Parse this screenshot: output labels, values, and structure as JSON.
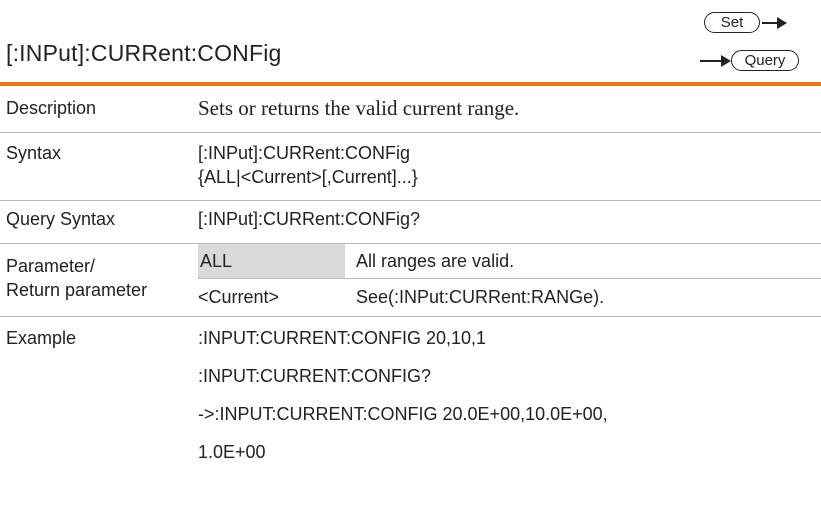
{
  "header": {
    "title": "[:INPut]:CURRent:CONFig",
    "set_badge": "Set",
    "query_badge": "Query"
  },
  "rows": {
    "description": {
      "label": "Description",
      "text": "Sets or returns the valid current range."
    },
    "syntax": {
      "label": "Syntax",
      "line1": "[:INPut]:CURRent:CONFig",
      "line2": "{ALL|<Current>[,Current]...}"
    },
    "query_syntax": {
      "label": "Query Syntax",
      "text": "[:INPut]:CURRent:CONFig?"
    },
    "parameter": {
      "label_line1": "Parameter/",
      "label_line2": "Return parameter",
      "items": [
        {
          "name": "ALL",
          "desc": "All ranges are valid."
        },
        {
          "name": "<Current>",
          "desc": "See(:INPut:CURRent:RANGe)."
        }
      ]
    },
    "example": {
      "label": "Example",
      "lines": [
        ":INPUT:CURRENT:CONFIG 20,10,1",
        ":INPUT:CURRENT:CONFIG?",
        "->:INPUT:CURRENT:CONFIG 20.0E+00,10.0E+00,",
        "1.0E+00"
      ]
    }
  },
  "colors": {
    "accent_rule": "#e87722",
    "param_highlight": "#d9d9d9",
    "divider": "#b8b8b8"
  }
}
